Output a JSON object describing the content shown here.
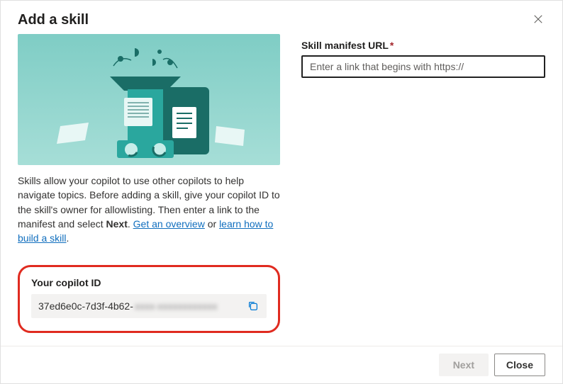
{
  "dialog": {
    "title": "Add a skill"
  },
  "description": {
    "text_before_bold": "Skills allow your copilot to use other copilots to help navigate topics. Before adding a skill, give your copilot ID to the skill's owner for allowlisting. Then enter a link to the manifest and select ",
    "bold_word": "Next",
    "after_bold": ". ",
    "link_overview": "Get an overview",
    "between_links": " or ",
    "link_learn": "learn how to build a skill",
    "period": "."
  },
  "copilot_id": {
    "label": "Your copilot ID",
    "value_visible": "37ed6e0c-7d3f-4b62-",
    "value_blurred": "xxxx-xxxxxxxxxxxx"
  },
  "form": {
    "url_label": "Skill manifest URL",
    "url_placeholder": "Enter a link that begins with https://"
  },
  "footer": {
    "next_label": "Next",
    "close_label": "Close"
  }
}
